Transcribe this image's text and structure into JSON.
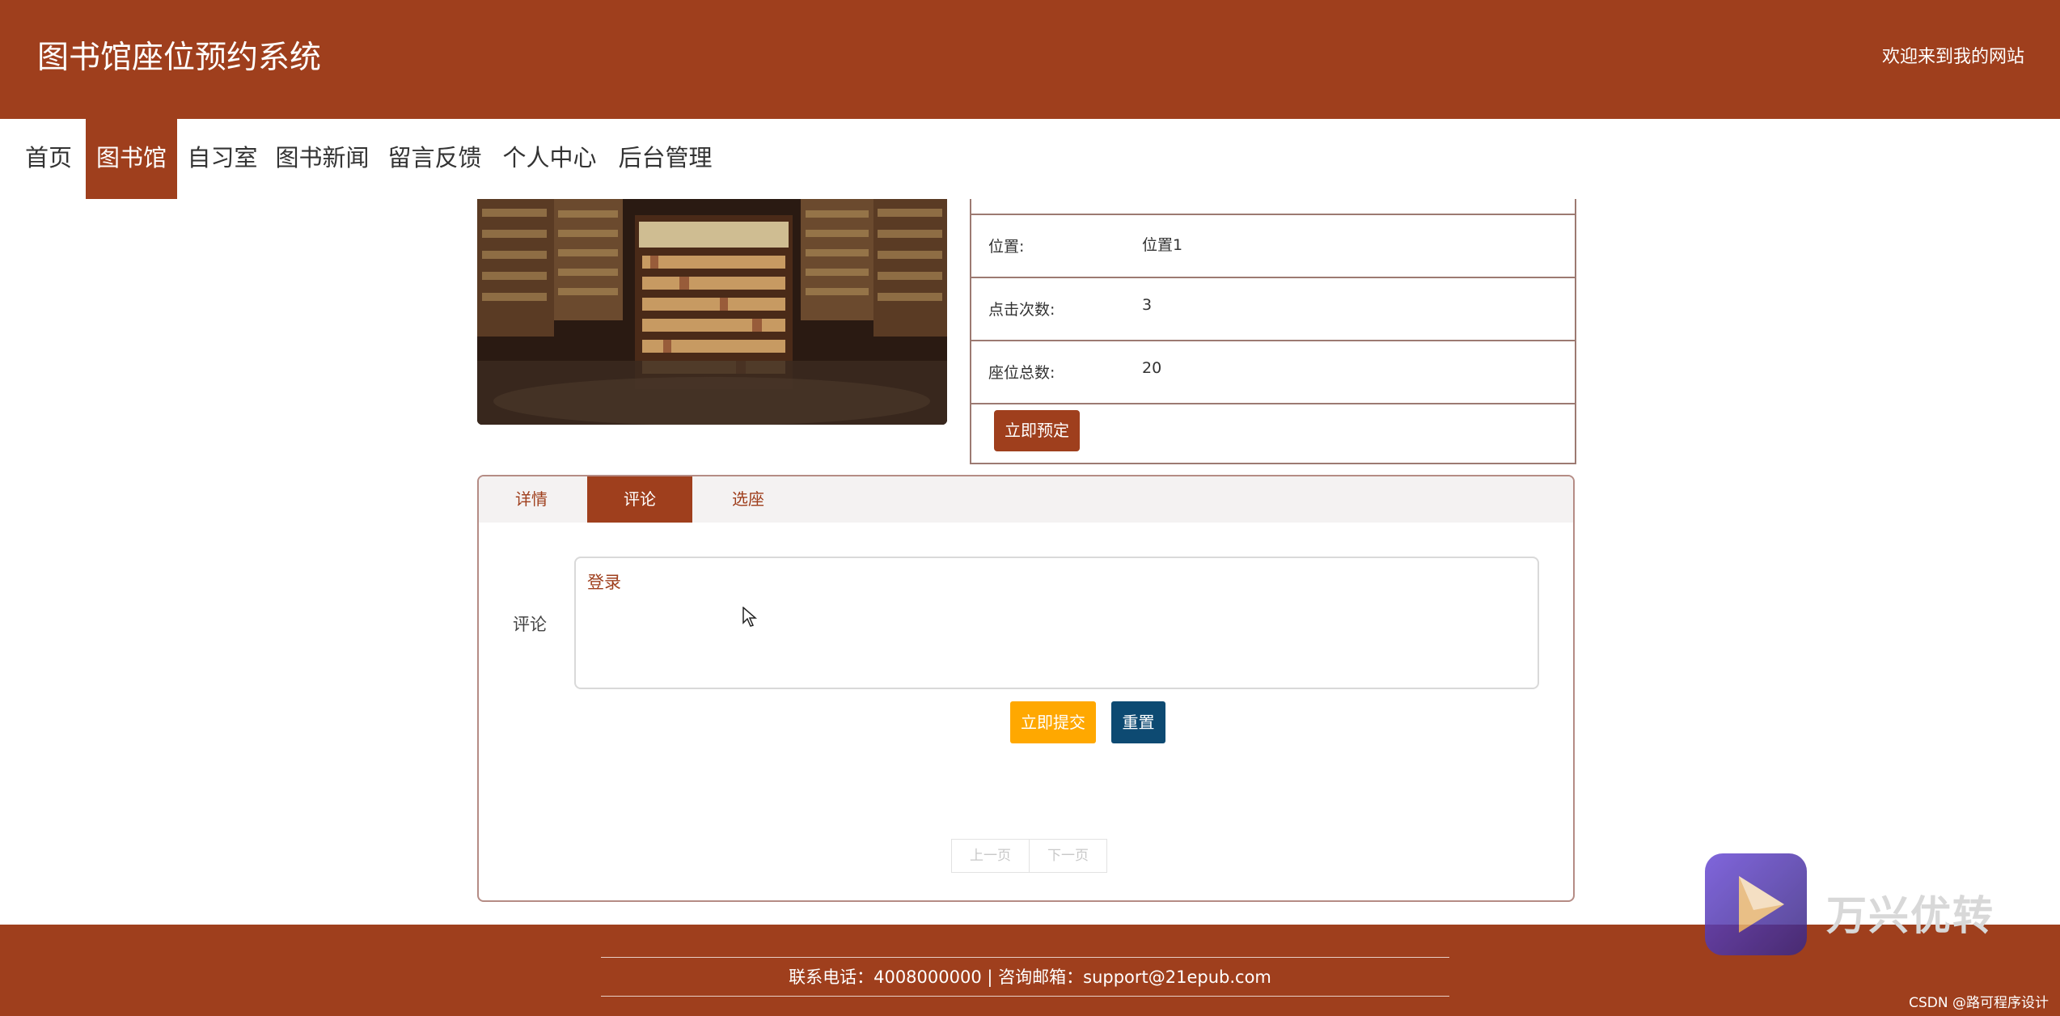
{
  "header": {
    "title": "图书馆座位预约系统",
    "welcome": "欢迎来到我的网站"
  },
  "nav": {
    "items": [
      {
        "label": "首页",
        "active": false
      },
      {
        "label": "图书馆",
        "active": true
      },
      {
        "label": "自习室",
        "active": false
      },
      {
        "label": "图书新闻",
        "active": false
      },
      {
        "label": "留言反馈",
        "active": false
      },
      {
        "label": "个人中心",
        "active": false
      },
      {
        "label": "后台管理",
        "active": false
      }
    ]
  },
  "detail": {
    "rows": [
      {
        "label": "位置:",
        "value": "位置1"
      },
      {
        "label": "点击次数:",
        "value": "3"
      },
      {
        "label": "座位总数:",
        "value": "20"
      }
    ],
    "book_button": "立即预定"
  },
  "tabs": [
    {
      "label": "详情",
      "active": false
    },
    {
      "label": "评论",
      "active": true
    },
    {
      "label": "选座",
      "active": false
    }
  ],
  "comment": {
    "label": "评论",
    "value": "登录",
    "submit": "立即提交",
    "reset": "重置"
  },
  "pagination": {
    "prev": "上一页",
    "next": "下一页"
  },
  "footer": {
    "contact": "联系电话：4008000000 | 咨询邮箱：support@21epub.com",
    "csdn": "CSDN @路可程序设计"
  },
  "watermark": {
    "text": "万兴优转"
  },
  "colors": {
    "brand": "#9f3f1d",
    "submit": "#ffa800",
    "reset": "#0d4a72"
  }
}
